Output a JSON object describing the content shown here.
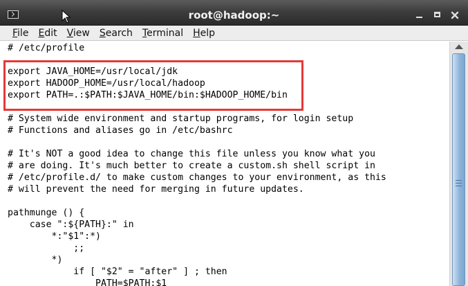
{
  "window": {
    "title": "root@hadoop:~"
  },
  "menu": [
    {
      "label": "File",
      "accel": "F",
      "rest": "ile"
    },
    {
      "label": "Edit",
      "accel": "E",
      "rest": "dit"
    },
    {
      "label": "View",
      "accel": "V",
      "rest": "iew"
    },
    {
      "label": "Search",
      "accel": "S",
      "rest": "earch"
    },
    {
      "label": "Terminal",
      "accel": "T",
      "rest": "erminal"
    },
    {
      "label": "Help",
      "accel": "H",
      "rest": "elp"
    }
  ],
  "terminal": {
    "lines": [
      "# /etc/profile",
      "",
      "export JAVA_HOME=/usr/local/jdk",
      "export HADOOP_HOME=/usr/local/hadoop",
      "export PATH=.:$PATH:$JAVA_HOME/bin:$HADOOP_HOME/bin",
      "",
      "# System wide environment and startup programs, for login setup",
      "# Functions and aliases go in /etc/bashrc",
      "",
      "# It's NOT a good idea to change this file unless you know what you",
      "# are doing. It's much better to create a custom.sh shell script in",
      "# /etc/profile.d/ to make custom changes to your environment, as this",
      "# will prevent the need for merging in future updates.",
      "",
      "pathmunge () {",
      "    case \":${PATH}:\" in",
      "        *:\"$1\":*)",
      "            ;;",
      "        *)",
      "            if [ \"$2\" = \"after\" ] ; then",
      "                PATH=$PATH:$1"
    ]
  },
  "colors": {
    "highlight_box": "#e53935",
    "scrollbar_thumb": "#8fb5da"
  }
}
